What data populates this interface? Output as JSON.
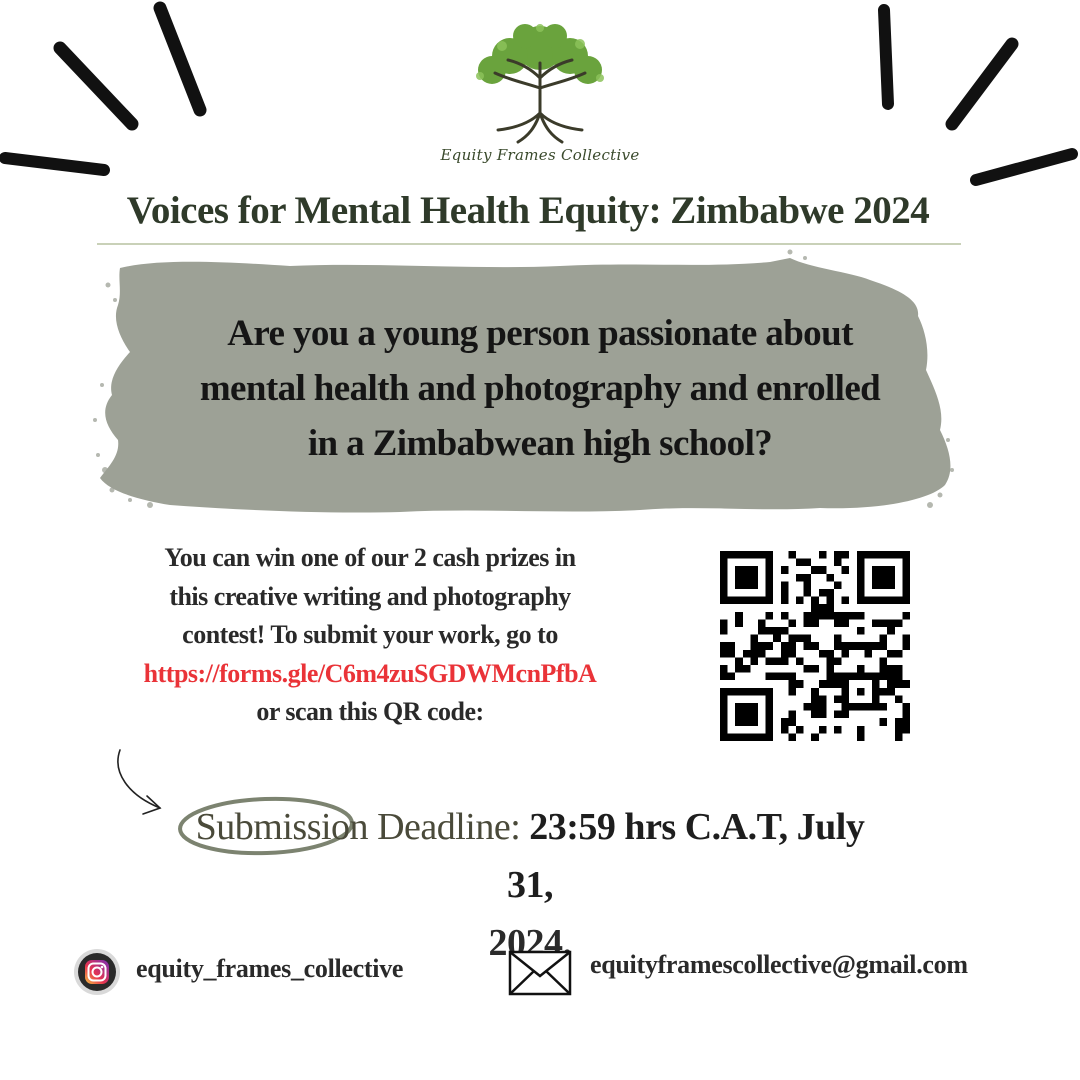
{
  "brand": {
    "name": "Equity Frames Collective",
    "logo_icon": "tree-of-life-icon"
  },
  "title": "Voices for Mental Health Equity: Zimbabwe 2024",
  "question": {
    "line1": "Are you a young person passionate about",
    "line2": "mental health and photography and enrolled",
    "line3": "in a Zimbabwean high school?"
  },
  "body": {
    "line1": "You can win one of our 2 cash prizes in",
    "line2": "this creative writing and photography",
    "line3": "contest! To submit your work, go to",
    "link": "https://forms.gle/C6m4zuSGDWMcnPfbA",
    "line5": "or scan this QR code:"
  },
  "qr_icon": "qr-code-icon",
  "deadline": {
    "label_part1": "Submission",
    "label_part2": " Deadline: ",
    "value": "23:59 hrs C.A.T,  July 31,",
    "year": "2024."
  },
  "contacts": {
    "instagram": "equity_frames_collective",
    "email": "equityframescollective@gmail.com"
  },
  "colors": {
    "title": "#2f3a2a",
    "brush": "#9da196",
    "link": "#ea3338",
    "logo_green": "#5f9a3a"
  }
}
